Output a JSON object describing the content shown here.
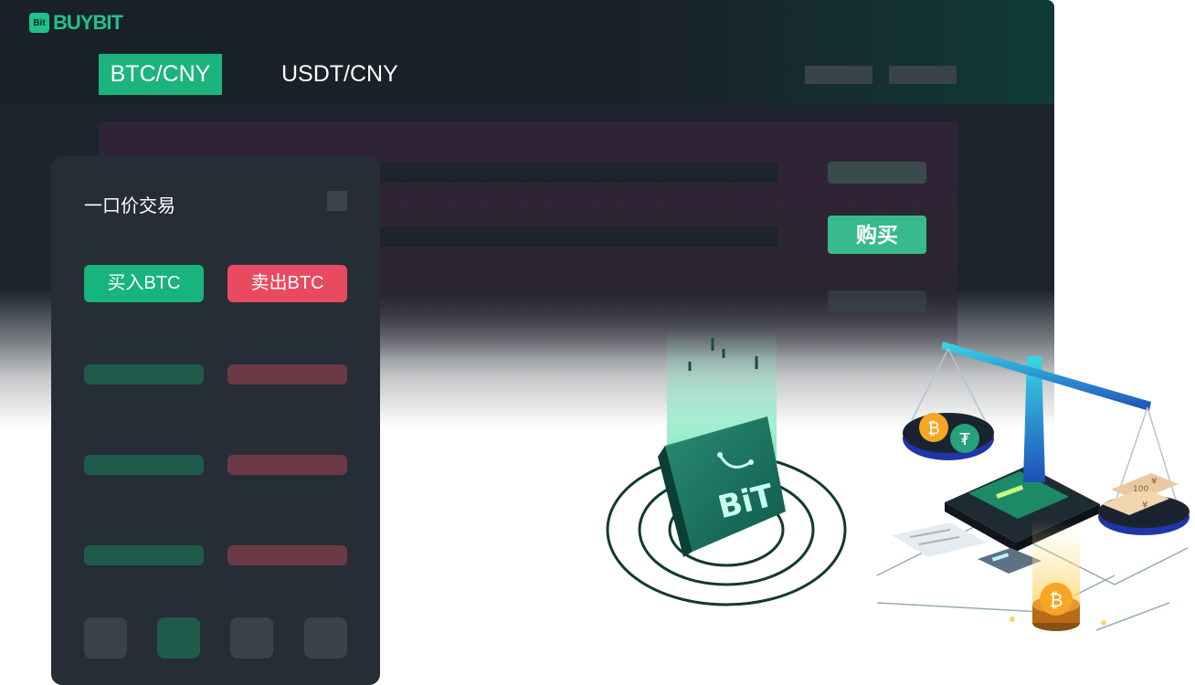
{
  "brand": {
    "logo_mark": "Bit",
    "logo_text": "BUYBIT",
    "accent": "#1cb37c",
    "danger": "#e84a5f"
  },
  "tabs": [
    {
      "label": "BTC/CNY",
      "active": true
    },
    {
      "label": "USDT/CNY",
      "active": false
    }
  ],
  "back_panel": {
    "buy_label": "购买"
  },
  "card": {
    "title": "一口价交易",
    "buy_label": "买入BTC",
    "sell_label": "卖出BTC"
  },
  "illustration": {
    "bag_text": "BiT",
    "coin_btc": "₿",
    "coin_usdt": "₮",
    "banknote": "100",
    "yen": "¥"
  }
}
